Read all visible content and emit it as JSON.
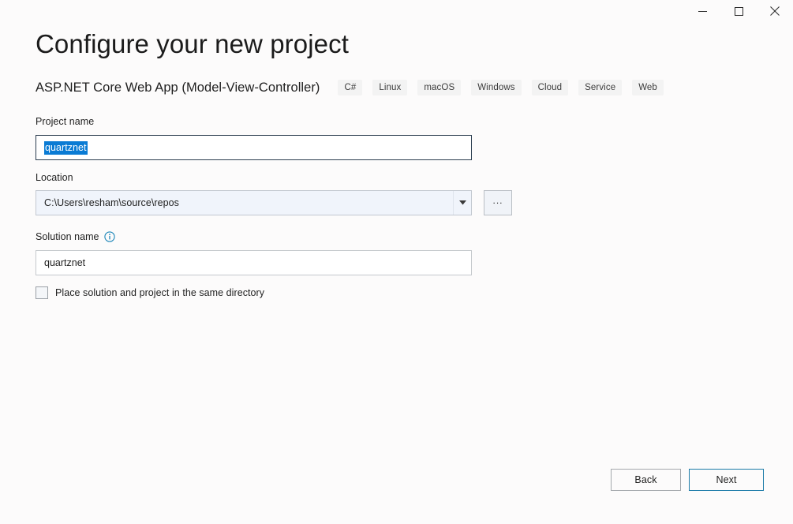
{
  "window": {
    "controls": [
      {
        "name": "minimize",
        "glyph": "minimize-icon"
      },
      {
        "name": "maximize",
        "glyph": "maximize-icon"
      },
      {
        "name": "close",
        "glyph": "close-icon"
      }
    ]
  },
  "header": {
    "title": "Configure your new project",
    "template_name": "ASP.NET Core Web App (Model-View-Controller)",
    "tags": [
      "C#",
      "Linux",
      "macOS",
      "Windows",
      "Cloud",
      "Service",
      "Web"
    ]
  },
  "form": {
    "project_name": {
      "label": "Project name",
      "value": "quartznet",
      "selected": true
    },
    "location": {
      "label": "Location",
      "value": "C:\\Users\\resham\\source\\repos",
      "dropdown_icon": "chevron-down-icon",
      "browse_label": "..."
    },
    "solution_name": {
      "label": "Solution name",
      "info_icon": "info-icon",
      "value": "quartznet"
    },
    "same_directory": {
      "label": "Place solution and project in the same directory",
      "checked": false
    }
  },
  "footer": {
    "back_label": "Back",
    "next_label": "Next"
  },
  "colors": {
    "background": "#fcfbfb",
    "selection_blue": "#0a7bd4",
    "accent_border": "#1a7aa8",
    "info_icon": "#1c86b8",
    "focus_border": "#2c3e50",
    "combobox_fill": "#f0f4fb"
  }
}
